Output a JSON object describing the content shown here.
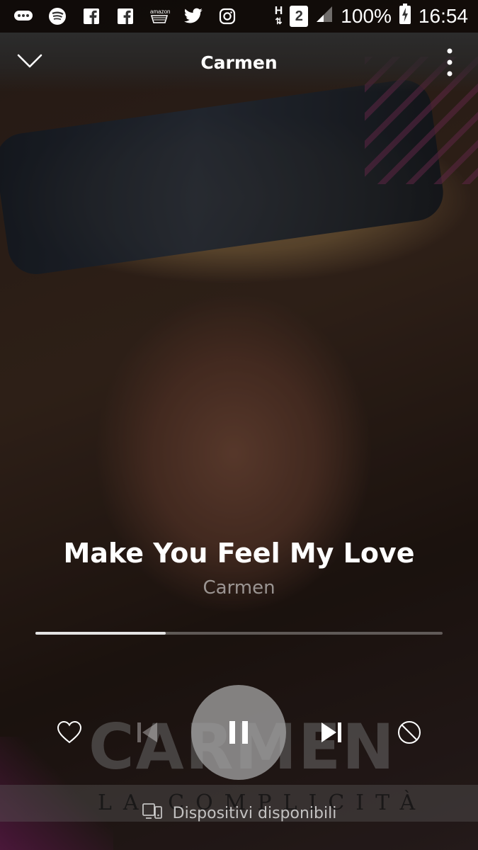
{
  "status_bar": {
    "left_icons": [
      "messages-icon",
      "spotify-icon",
      "facebook-icon",
      "facebook-icon",
      "amazon-icon",
      "twitter-icon",
      "instagram-icon"
    ],
    "network_label": "H",
    "sim_label": "2",
    "battery": "100%",
    "time": "16:54"
  },
  "header": {
    "title": "Carmen"
  },
  "artwork": {
    "logo_text": "CARMEN",
    "album_title": "LA COMPLICITÀ"
  },
  "track": {
    "title": "Make You Feel My Love",
    "artist": "Carmen",
    "progress": 0.32
  },
  "devices": {
    "label": "Dispositivi disponibili"
  },
  "colors": {
    "accent": "#ffffff",
    "play_button": "#a0a0a0"
  }
}
